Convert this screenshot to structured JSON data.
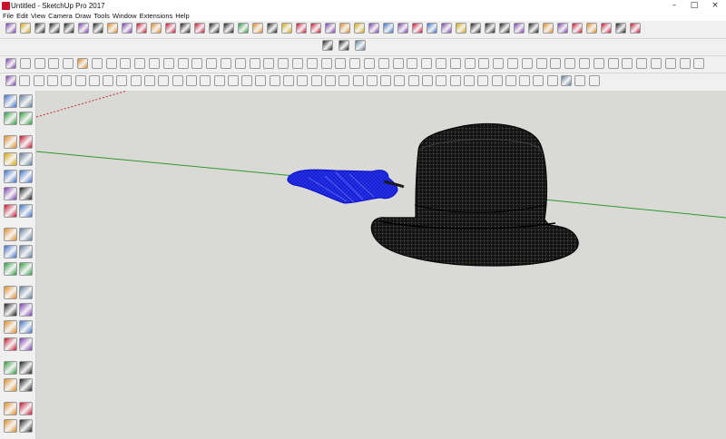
{
  "window": {
    "title": "Untitled - SketchUp Pro 2017",
    "minimize_label": "–",
    "maximize_label": "□",
    "close_label": "×"
  },
  "menu": [
    "File",
    "Edit",
    "View",
    "Camera",
    "Draw",
    "Tools",
    "Window",
    "Extensions",
    "Help"
  ],
  "colors": {
    "canvas": "#d9d9d6",
    "toolbar": "#f0f0f0",
    "green_axis": "#2e9a2e",
    "red_axis": "#c02020",
    "mesh_dark": "#141414",
    "mesh_selected": "#1a22e6"
  },
  "toolbar_icons": [
    "orbit",
    "pan",
    "zoom",
    "undo",
    "redo",
    "paint",
    "move",
    "rotate",
    "scale",
    "push-pull",
    "offset",
    "follow-me",
    "tape",
    "dimension",
    "text",
    "axes",
    "section",
    "camera",
    "walk",
    "look-around",
    "warehouse",
    "extension",
    "style",
    "shadow",
    "fog",
    "layer",
    "outliner",
    "scene",
    "component",
    "material"
  ],
  "left_toolbar_icons": [
    "select-icon",
    "component-icon",
    "paint-icon",
    "eraser-icon",
    "line-icon",
    "freehand-icon",
    "rectangle-icon",
    "rotated-rectangle-icon",
    "circle-icon",
    "polygon-icon",
    "arc-icon",
    "pie-icon",
    "arc-3pt-icon",
    "arc-2pt-icon",
    "move-icon",
    "push-pull-icon",
    "rotate-icon",
    "follow-me-icon",
    "scale-icon",
    "offset-icon",
    "tape-icon",
    "dimension-icon",
    "protractor-icon",
    "text-icon",
    "axes-icon",
    "3d-text-icon",
    "section-icon",
    "paint-bucket-icon",
    "orbit-icon",
    "pan-icon",
    "zoom-icon",
    "zoom-window-icon",
    "zoom-extents-icon",
    "previous-icon",
    "walk-icon",
    "look-around-icon"
  ]
}
